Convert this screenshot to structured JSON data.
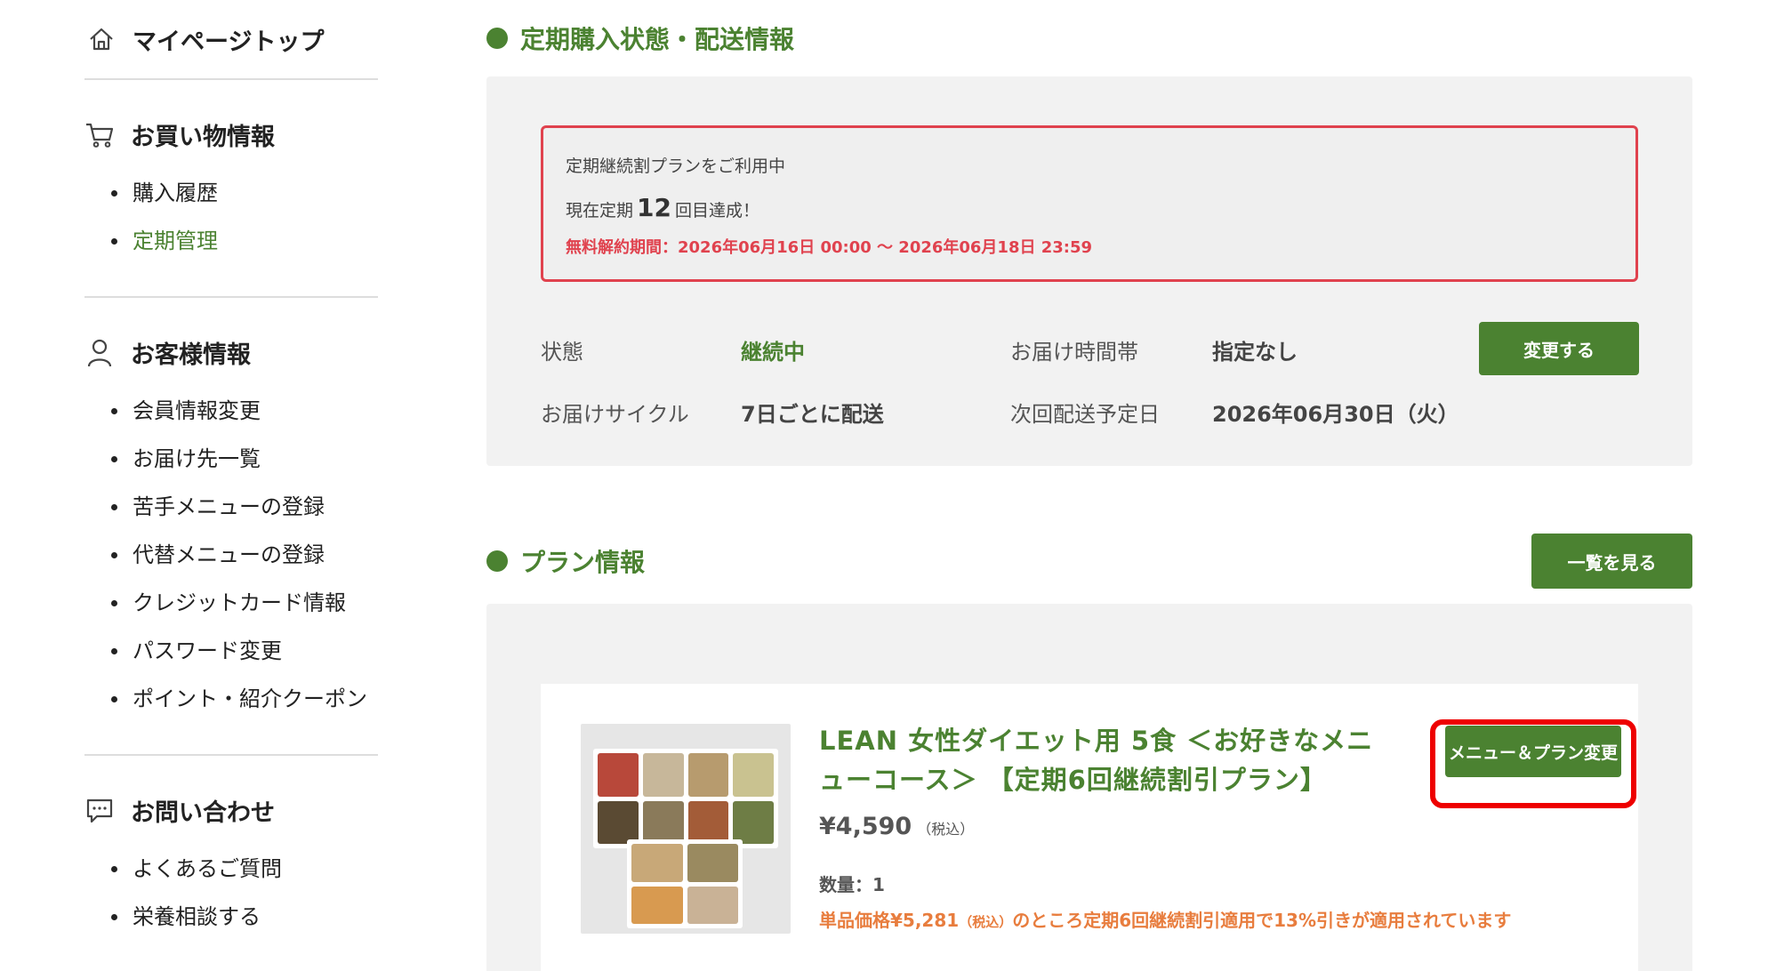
{
  "sidebar": {
    "mypage_top": "マイページトップ",
    "shopping": {
      "heading": "お買い物情報",
      "items": [
        "購入履歴",
        "定期管理"
      ]
    },
    "customer": {
      "heading": "お客様情報",
      "items": [
        "会員情報変更",
        "お届け先一覧",
        "苦手メニューの登録",
        "代替メニューの登録",
        "クレジットカード情報",
        "パスワード変更",
        "ポイント・紹介クーポン"
      ]
    },
    "contact": {
      "heading": "お問い合わせ",
      "items": [
        "よくあるご質問",
        "栄養相談する"
      ]
    }
  },
  "subscription": {
    "title": "定期購入状態・配送情報",
    "notice": {
      "line1": "定期継続割プランをご利用中",
      "line2_prefix": "現在定期",
      "count": "12",
      "line2_suffix": "回目達成！",
      "cancel_period": "無料解約期間：2026年06月16日 00:00 〜 2026年06月18日 23:59"
    },
    "status_label": "状態",
    "status_value": "継続中",
    "time_label": "お届け時間帯",
    "time_value": "指定なし",
    "cycle_label": "お届けサイクル",
    "cycle_value": "7日ごとに配送",
    "next_label": "次回配送予定日",
    "next_value": "2026年06月30日（火）",
    "change_button": "変更する"
  },
  "plan": {
    "title": "プラン情報",
    "list_button": "一覧を見る",
    "product_name": "LEAN 女性ダイエット用 5食 ＜お好きなメニューコース＞ 【定期6回継続割引プラン】",
    "price": "¥4,590",
    "tax_label": "（税込）",
    "quantity": "数量：1",
    "discount_prefix": "単品価格¥5,281",
    "discount_tax": "（税込）",
    "discount_suffix": "のところ定期6回継続割引適用で13%引きが適用されています",
    "menu_change_button": "メニュー＆プラン変更"
  },
  "colors": {
    "brand_green": "#4b8231",
    "alert_red": "#e0424e",
    "discount_orange": "#e87d3e",
    "highlight_red": "#ee0000"
  },
  "icons": [
    "home-icon",
    "cart-icon",
    "person-icon",
    "chat-icon"
  ]
}
